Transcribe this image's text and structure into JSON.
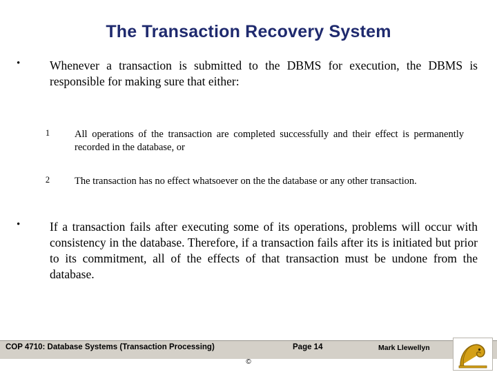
{
  "slide": {
    "title": "The Transaction Recovery System",
    "bullets": [
      {
        "marker": "•",
        "text": "Whenever a transaction is submitted to the DBMS for execution, the DBMS is responsible for making sure that either:"
      },
      {
        "marker": "•",
        "text": "If a transaction fails after executing some of its operations, problems will occur with consistency in the database. Therefore, if a transaction fails after its is initiated but prior to its commitment, all of the effects of that transaction must be undone from the database."
      }
    ],
    "numbered": [
      {
        "num": "1",
        "text": "All operations of the transaction are completed successfully and their effect is permanently recorded in the database, or"
      },
      {
        "num": "2",
        "text": "The transaction has no effect whatsoever on the the database or any other transaction."
      }
    ]
  },
  "footer": {
    "course": "COP 4710: Database Systems",
    "course_sub": "(Transaction Processing)",
    "page": "Page 14",
    "author": "Mark Llewellyn",
    "copyright": "©"
  },
  "colors": {
    "title": "#1f2a6e",
    "footer_bar": "#d4d0c8",
    "body_text": "#000000",
    "logo_gold": "#d4a017"
  },
  "logo": {
    "name": "ucf-knight-logo"
  }
}
